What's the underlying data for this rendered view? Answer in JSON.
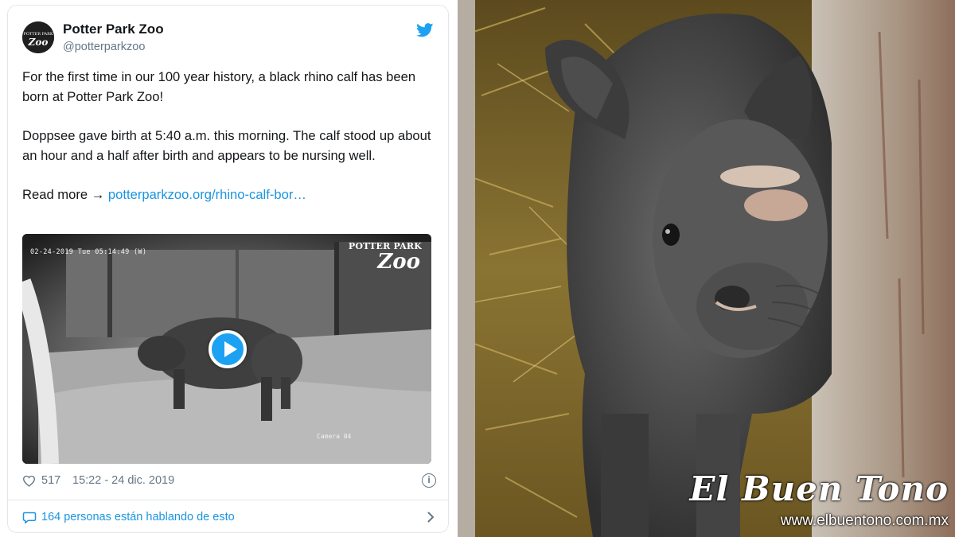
{
  "tweet": {
    "author_name": "Potter Park Zoo",
    "author_handle": "@potterparkzoo",
    "paragraph_1": "For the first time in our 100 year history, a black rhino calf has been born at Potter Park Zoo!",
    "paragraph_2": "Doppsee gave birth at 5:40 a.m. this morning. The calf stood up about an hour and a half after birth and appears to be nursing well.",
    "read_more_label": "Read more →",
    "link_text": "potterparkzoo.org/rhino-calf-bor…",
    "media": {
      "camera_timestamp": "02-24-2019 Tue 05:14:49 (W)",
      "camera_label": "Camera 04",
      "logo_line_1": "POTTER PARK",
      "logo_line_2": "Zoo"
    },
    "likes": "517",
    "posted_at": "15:22 - 24 dic. 2019",
    "replies_text": "164 personas están hablando de esto"
  },
  "photo": {
    "watermark_title": "El Buen Tono",
    "watermark_url": "www.elbuentono.com.mx"
  },
  "colors": {
    "twitter_blue": "#1da1f2",
    "link_blue": "#1b95e0",
    "text_primary": "#14171a",
    "text_secondary": "#657786",
    "border": "#e1e8ed"
  },
  "icons": [
    "twitter-bird-icon",
    "heart-icon",
    "info-icon",
    "comment-icon",
    "chevron-right-icon",
    "play-icon"
  ]
}
